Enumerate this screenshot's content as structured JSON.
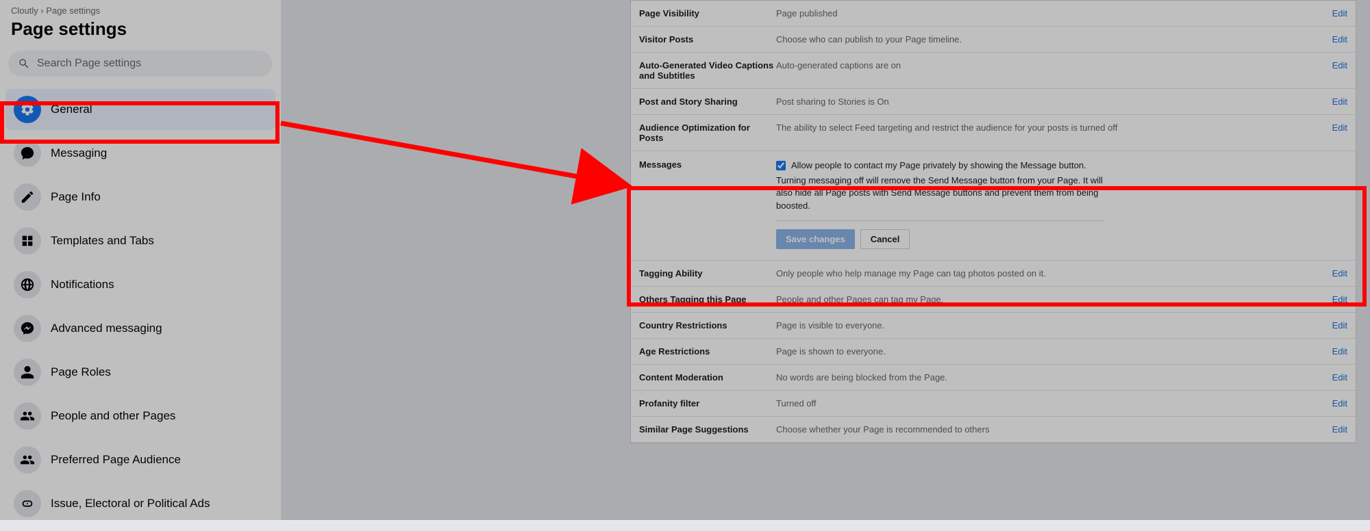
{
  "breadcrumb": "Cloutly › Page settings",
  "page_title": "Page settings",
  "search_placeholder": "Search Page settings",
  "nav": [
    {
      "label": "General",
      "icon": "gear",
      "active": true
    },
    {
      "label": "Messaging",
      "icon": "chat"
    },
    {
      "label": "Page Info",
      "icon": "pencil"
    },
    {
      "label": "Templates and Tabs",
      "icon": "grid"
    },
    {
      "label": "Notifications",
      "icon": "globe"
    },
    {
      "label": "Advanced messaging",
      "icon": "messenger"
    },
    {
      "label": "Page Roles",
      "icon": "person"
    },
    {
      "label": "People and other Pages",
      "icon": "people"
    },
    {
      "label": "Preferred Page Audience",
      "icon": "people"
    },
    {
      "label": "Issue, Electoral or Political Ads",
      "icon": "link"
    }
  ],
  "edit_label": "Edit",
  "rows": [
    {
      "label": "Page Visibility",
      "value": "Page published"
    },
    {
      "label": "Visitor Posts",
      "value": "Choose who can publish to your Page timeline."
    },
    {
      "label": "Auto-Generated Video Captions and Subtitles",
      "value": "Auto-generated captions are on"
    },
    {
      "label": "Post and Story Sharing",
      "value": "Post sharing to Stories is On"
    },
    {
      "label": "Audience Optimization for Posts",
      "value": "The ability to select Feed targeting and restrict the audience for your posts is turned off"
    }
  ],
  "messages": {
    "label": "Messages",
    "checkbox_text": "Allow people to contact my Page privately by showing the Message button.",
    "desc": "Turning messaging off will remove the Send Message button from your Page. It will also hide all Page posts with Send Message buttons and prevent them from being boosted.",
    "save": "Save changes",
    "cancel": "Cancel"
  },
  "rows_after": [
    {
      "label": "Tagging Ability",
      "value": "Only people who help manage my Page can tag photos posted on it."
    },
    {
      "label": "Others Tagging this Page",
      "value": "People and other Pages can tag my Page."
    },
    {
      "label": "Country Restrictions",
      "value": "Page is visible to everyone."
    },
    {
      "label": "Age Restrictions",
      "value": "Page is shown to everyone."
    },
    {
      "label": "Content Moderation",
      "value": "No words are being blocked from the Page."
    },
    {
      "label": "Profanity filter",
      "value": "Turned off"
    },
    {
      "label": "Similar Page Suggestions",
      "value": "Choose whether your Page is recommended to others"
    }
  ]
}
